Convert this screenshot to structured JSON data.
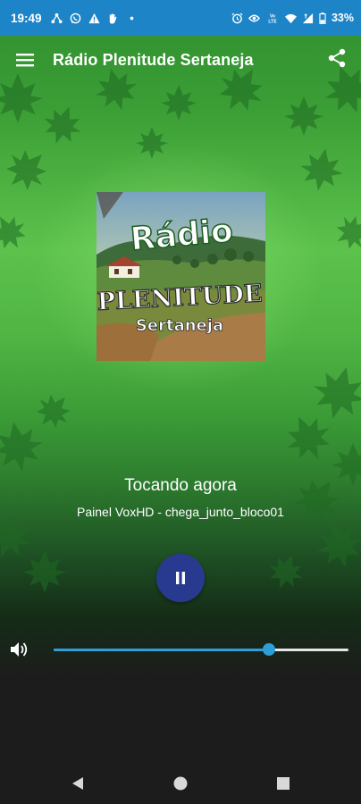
{
  "status_bar": {
    "time": "19:49",
    "battery": "33%",
    "left_icons": [
      "network-icon",
      "whatsapp-icon",
      "warning-icon",
      "hand-icon",
      "dot-icon"
    ],
    "right_icons": [
      "alarm-icon",
      "eye-icon",
      "volte-icon",
      "wifi-icon",
      "signal-icon",
      "battery-icon"
    ],
    "volte_text": "Vo\nLTE",
    "color": "#1d84c7"
  },
  "app_bar": {
    "title": "Rádio Plenitude Sertaneja",
    "menu_icon": "hamburger-menu-icon",
    "share_icon": "share-icon"
  },
  "cover": {
    "line1": "Rádio",
    "line2": "PLENITUDE",
    "line3": "Sertaneja"
  },
  "player": {
    "now_playing_label": "Tocando agora",
    "track": "Painel VoxHD - chega_junto_bloco01",
    "state": "playing",
    "pause_icon": "pause-icon",
    "accent": "#283a8f"
  },
  "volume": {
    "icon": "volume-icon",
    "level": 0.73,
    "accent": "#2c9fd6"
  },
  "nav_bar": {
    "back_icon": "back-triangle-icon",
    "home_icon": "home-circle-icon",
    "recents_icon": "recents-square-icon"
  }
}
